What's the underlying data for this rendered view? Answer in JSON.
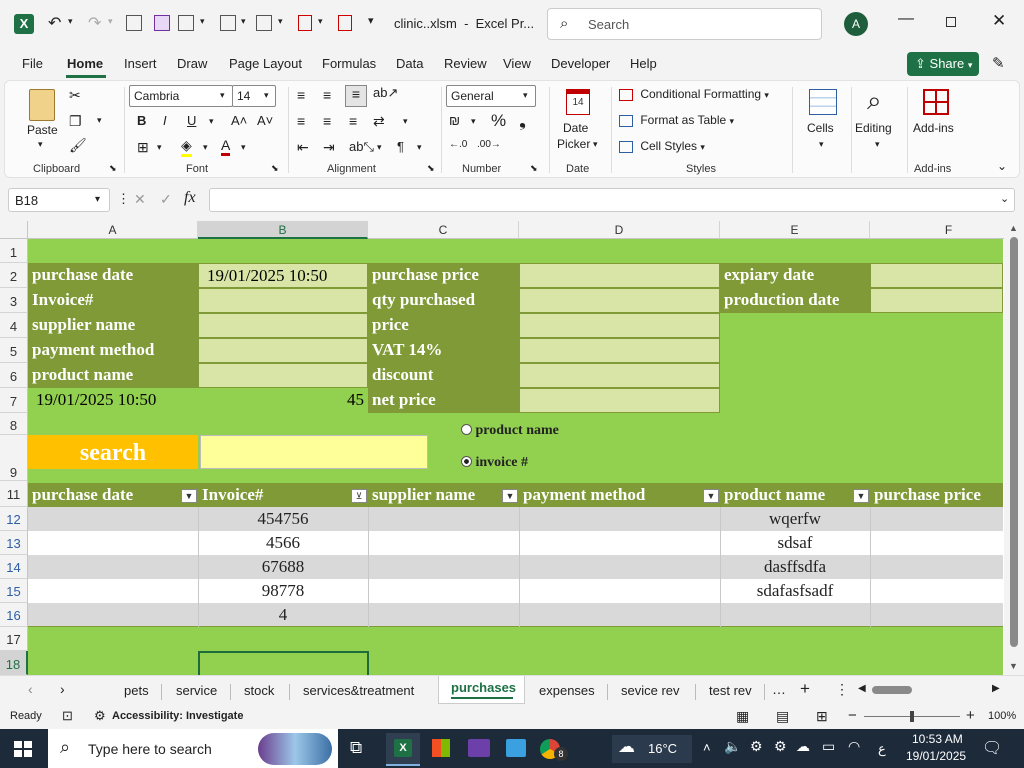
{
  "title_bar": {
    "filename": "clinic..xlsm",
    "app": "Excel Pr...",
    "search_placeholder": "Search",
    "avatar_initial": "A"
  },
  "menu": [
    "File",
    "Home",
    "Insert",
    "Draw",
    "Page Layout",
    "Formulas",
    "Data",
    "Review",
    "View",
    "Developer",
    "Help"
  ],
  "share_label": "Share",
  "ribbon": {
    "paste": "Paste",
    "clipboard": "Clipboard",
    "font_name": "Cambria",
    "font_size": "14",
    "font": "Font",
    "alignment": "Alignment",
    "number_format": "General",
    "number": "Number",
    "date_picker": "Date\nPicker",
    "date_picker_1": "Date",
    "date_picker_2": "Picker",
    "date": "Date",
    "conditional_formatting": "Conditional Formatting",
    "format_as_table": "Format as Table",
    "cell_styles": "Cell Styles",
    "styles": "Styles",
    "cells": "Cells",
    "editing": "Editing",
    "addins": "Add-ins",
    "addins_group": "Add-ins",
    "calendar_day": "14"
  },
  "formula_bar": {
    "name_box": "B18",
    "fx": "fx",
    "formula": ""
  },
  "columns": [
    "A",
    "B",
    "C",
    "D",
    "E",
    "F"
  ],
  "rows": [
    "1",
    "2",
    "3",
    "4",
    "5",
    "6",
    "7",
    "8",
    "9",
    "11",
    "12",
    "13",
    "14",
    "15",
    "16",
    "17",
    "18"
  ],
  "form": {
    "purchase_date": "purchase date",
    "purchase_date_value": "19/01/2025 10:50",
    "invoice": "Invoice#",
    "supplier_name": "supplier name",
    "payment_method": "payment method",
    "product_name": "product name",
    "purchase_price": "purchase price",
    "qty_purchased": "qty purchased",
    "price": "price",
    "vat": "VAT 14%",
    "discount": "discount",
    "net_price": "net price",
    "expiry_date": "expiary date",
    "production_date": "production date",
    "a7_value": "19/01/2025 10:50",
    "b7_value": "45",
    "search_label": "search",
    "radio_product": "product name",
    "radio_invoice": "invoice #"
  },
  "table": {
    "headers": [
      "purchase date",
      "Invoice#",
      "supplier name",
      "payment method",
      "product name",
      "purchase price"
    ],
    "rows": [
      {
        "invoice": "454756",
        "product": "wqerfw"
      },
      {
        "invoice": "4566",
        "product": "sdsaf"
      },
      {
        "invoice": "67688",
        "product": "dasffsdfa"
      },
      {
        "invoice": "98778",
        "product": "sdafasfsadf"
      },
      {
        "invoice": "4",
        "product": ""
      }
    ]
  },
  "sheet_tabs": [
    "pets",
    "service",
    "stock",
    "services&treatment",
    "purchases",
    "expenses",
    "sevice rev",
    "test rev"
  ],
  "active_tab": "purchases",
  "status": {
    "ready": "Ready",
    "accessibility": "Accessibility: Investigate",
    "zoom": "100%"
  },
  "taskbar": {
    "search_placeholder": "Type here to search",
    "temperature": "16°C",
    "time": "10:53 AM",
    "date": "19/01/2025",
    "lang": "ع",
    "notif_count": "8"
  },
  "colors": {
    "sheet_green": "#92d050",
    "label_olive": "#7f9a36",
    "input_light": "#d8e5a6",
    "search_orange": "#ffc000",
    "search_input": "#ffff99",
    "excel_green": "#1e7145"
  }
}
